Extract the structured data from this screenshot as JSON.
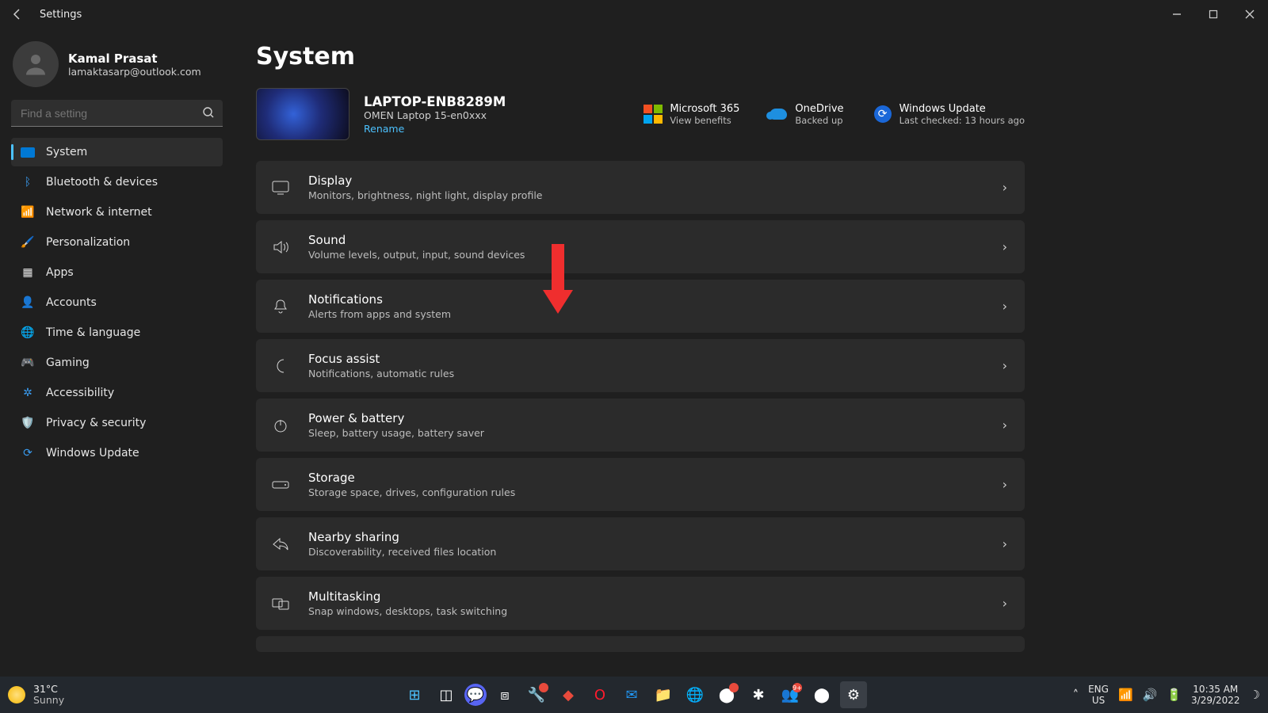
{
  "window": {
    "title": "Settings"
  },
  "user": {
    "name": "Kamal Prasat",
    "email": "lamaktasarp@outlook.com"
  },
  "search": {
    "placeholder": "Find a setting"
  },
  "nav": {
    "items": [
      {
        "label": "System"
      },
      {
        "label": "Bluetooth & devices"
      },
      {
        "label": "Network & internet"
      },
      {
        "label": "Personalization"
      },
      {
        "label": "Apps"
      },
      {
        "label": "Accounts"
      },
      {
        "label": "Time & language"
      },
      {
        "label": "Gaming"
      },
      {
        "label": "Accessibility"
      },
      {
        "label": "Privacy & security"
      },
      {
        "label": "Windows Update"
      }
    ]
  },
  "page": {
    "title": "System"
  },
  "device": {
    "name": "LAPTOP-ENB8289M",
    "model": "OMEN Laptop 15-en0xxx",
    "rename": "Rename"
  },
  "tiles": {
    "ms365": {
      "label": "Microsoft 365",
      "sub": "View benefits"
    },
    "onedrive": {
      "label": "OneDrive",
      "sub": "Backed up"
    },
    "update": {
      "label": "Windows Update",
      "sub": "Last checked: 13 hours ago"
    }
  },
  "cards": [
    {
      "title": "Display",
      "sub": "Monitors, brightness, night light, display profile"
    },
    {
      "title": "Sound",
      "sub": "Volume levels, output, input, sound devices"
    },
    {
      "title": "Notifications",
      "sub": "Alerts from apps and system"
    },
    {
      "title": "Focus assist",
      "sub": "Notifications, automatic rules"
    },
    {
      "title": "Power & battery",
      "sub": "Sleep, battery usage, battery saver"
    },
    {
      "title": "Storage",
      "sub": "Storage space, drives, configuration rules"
    },
    {
      "title": "Nearby sharing",
      "sub": "Discoverability, received files location"
    },
    {
      "title": "Multitasking",
      "sub": "Snap windows, desktops, task switching"
    }
  ],
  "taskbar": {
    "weather": {
      "temp": "31°C",
      "cond": "Sunny"
    },
    "lang": {
      "top": "ENG",
      "bottom": "US"
    },
    "clock": {
      "time": "10:35 AM",
      "date": "3/29/2022"
    }
  }
}
